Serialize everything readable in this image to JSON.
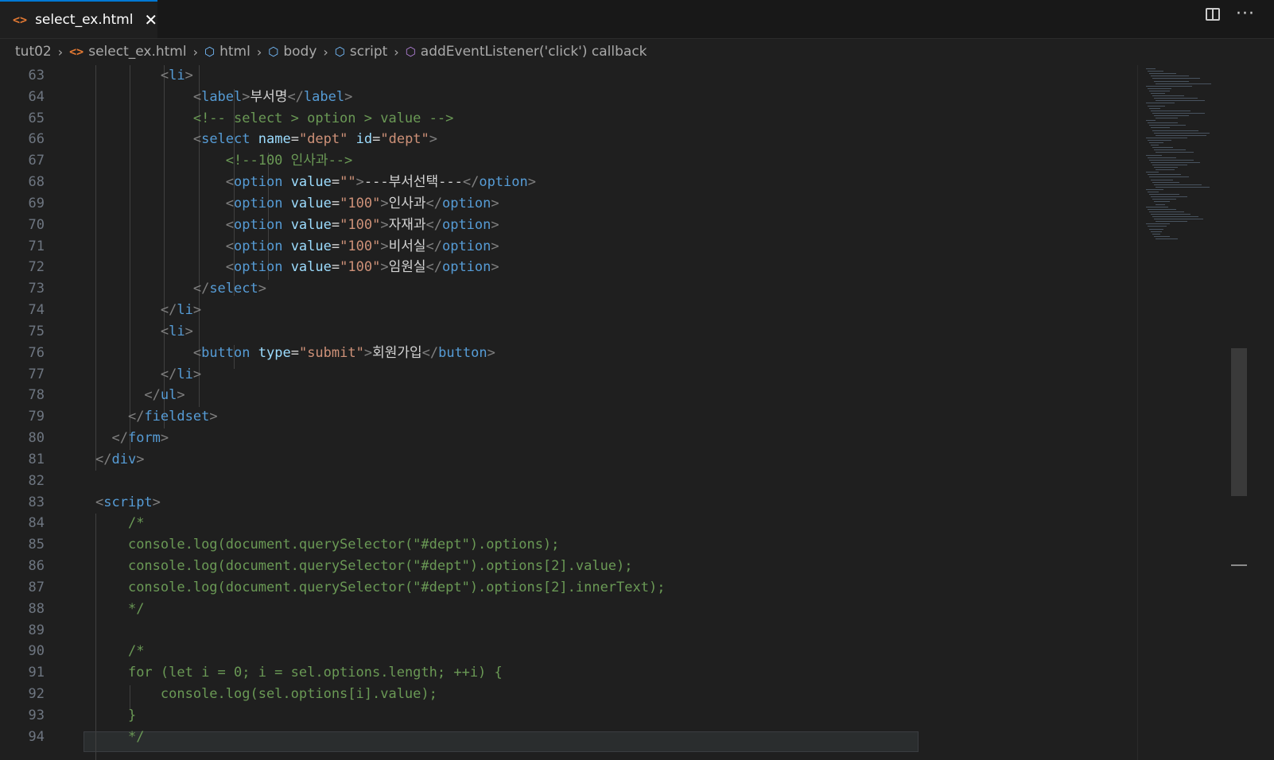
{
  "tab": {
    "label": "select_ex.html",
    "icon": "html-file-icon",
    "close_glyph": "✕"
  },
  "tab_actions": {
    "split_editor": "split-editor-icon",
    "more": "···"
  },
  "breadcrumb": [
    {
      "label": "tut02",
      "icon": ""
    },
    {
      "label": "select_ex.html",
      "icon": "html-file-icon"
    },
    {
      "label": "html",
      "icon": "symbol-element-icon"
    },
    {
      "label": "body",
      "icon": "symbol-element-icon"
    },
    {
      "label": "script",
      "icon": "symbol-element-icon"
    },
    {
      "label": "addEventListener('click') callback",
      "icon": "symbol-method-icon"
    }
  ],
  "line_numbers": [
    "63",
    "64",
    "65",
    "66",
    "67",
    "68",
    "69",
    "70",
    "71",
    "72",
    "73",
    "74",
    "75",
    "76",
    "77",
    "78",
    "79",
    "80",
    "81",
    "82",
    "83",
    "84",
    "85",
    "86",
    "87",
    "88",
    "89",
    "90",
    "91",
    "92",
    "93",
    "94"
  ],
  "code_lines": [
    [
      [
        "        ",
        "x"
      ],
      [
        "<",
        "p"
      ],
      [
        "li",
        "t"
      ],
      [
        ">",
        "p"
      ]
    ],
    [
      [
        "            ",
        "x"
      ],
      [
        "<",
        "p"
      ],
      [
        "label",
        "t"
      ],
      [
        ">",
        "p"
      ],
      [
        "부서명",
        "x"
      ],
      [
        "</",
        "p"
      ],
      [
        "label",
        "t"
      ],
      [
        ">",
        "p"
      ]
    ],
    [
      [
        "            ",
        "x"
      ],
      [
        "<!-- select > option > value -->",
        "c"
      ]
    ],
    [
      [
        "            ",
        "x"
      ],
      [
        "<",
        "p"
      ],
      [
        "select",
        "t"
      ],
      [
        " ",
        "x"
      ],
      [
        "name",
        "a"
      ],
      [
        "=",
        "x"
      ],
      [
        "\"dept\"",
        "s"
      ],
      [
        " ",
        "x"
      ],
      [
        "id",
        "a"
      ],
      [
        "=",
        "x"
      ],
      [
        "\"dept\"",
        "s"
      ],
      [
        ">",
        "p"
      ]
    ],
    [
      [
        "                ",
        "x"
      ],
      [
        "<!--100 인사과-->",
        "c"
      ]
    ],
    [
      [
        "                ",
        "x"
      ],
      [
        "<",
        "p"
      ],
      [
        "option",
        "t"
      ],
      [
        " ",
        "x"
      ],
      [
        "value",
        "a"
      ],
      [
        "=",
        "x"
      ],
      [
        "\"\"",
        "s"
      ],
      [
        ">",
        "p"
      ],
      [
        "---부서선택---",
        "x"
      ],
      [
        "</",
        "p"
      ],
      [
        "option",
        "t"
      ],
      [
        ">",
        "p"
      ]
    ],
    [
      [
        "                ",
        "x"
      ],
      [
        "<",
        "p"
      ],
      [
        "option",
        "t"
      ],
      [
        " ",
        "x"
      ],
      [
        "value",
        "a"
      ],
      [
        "=",
        "x"
      ],
      [
        "\"100\"",
        "s"
      ],
      [
        ">",
        "p"
      ],
      [
        "인사과",
        "x"
      ],
      [
        "</",
        "p"
      ],
      [
        "option",
        "t"
      ],
      [
        ">",
        "p"
      ]
    ],
    [
      [
        "                ",
        "x"
      ],
      [
        "<",
        "p"
      ],
      [
        "option",
        "t"
      ],
      [
        " ",
        "x"
      ],
      [
        "value",
        "a"
      ],
      [
        "=",
        "x"
      ],
      [
        "\"100\"",
        "s"
      ],
      [
        ">",
        "p"
      ],
      [
        "자재과",
        "x"
      ],
      [
        "</",
        "p"
      ],
      [
        "option",
        "t"
      ],
      [
        ">",
        "p"
      ]
    ],
    [
      [
        "                ",
        "x"
      ],
      [
        "<",
        "p"
      ],
      [
        "option",
        "t"
      ],
      [
        " ",
        "x"
      ],
      [
        "value",
        "a"
      ],
      [
        "=",
        "x"
      ],
      [
        "\"100\"",
        "s"
      ],
      [
        ">",
        "p"
      ],
      [
        "비서실",
        "x"
      ],
      [
        "</",
        "p"
      ],
      [
        "option",
        "t"
      ],
      [
        ">",
        "p"
      ]
    ],
    [
      [
        "                ",
        "x"
      ],
      [
        "<",
        "p"
      ],
      [
        "option",
        "t"
      ],
      [
        " ",
        "x"
      ],
      [
        "value",
        "a"
      ],
      [
        "=",
        "x"
      ],
      [
        "\"100\"",
        "s"
      ],
      [
        ">",
        "p"
      ],
      [
        "임원실",
        "x"
      ],
      [
        "</",
        "p"
      ],
      [
        "option",
        "t"
      ],
      [
        ">",
        "p"
      ]
    ],
    [
      [
        "            ",
        "x"
      ],
      [
        "</",
        "p"
      ],
      [
        "select",
        "t"
      ],
      [
        ">",
        "p"
      ]
    ],
    [
      [
        "        ",
        "x"
      ],
      [
        "</",
        "p"
      ],
      [
        "li",
        "t"
      ],
      [
        ">",
        "p"
      ]
    ],
    [
      [
        "        ",
        "x"
      ],
      [
        "<",
        "p"
      ],
      [
        "li",
        "t"
      ],
      [
        ">",
        "p"
      ]
    ],
    [
      [
        "            ",
        "x"
      ],
      [
        "<",
        "p"
      ],
      [
        "button",
        "t"
      ],
      [
        " ",
        "x"
      ],
      [
        "type",
        "a"
      ],
      [
        "=",
        "x"
      ],
      [
        "\"submit\"",
        "s"
      ],
      [
        ">",
        "p"
      ],
      [
        "회원가입",
        "x"
      ],
      [
        "</",
        "p"
      ],
      [
        "button",
        "t"
      ],
      [
        ">",
        "p"
      ]
    ],
    [
      [
        "        ",
        "x"
      ],
      [
        "</",
        "p"
      ],
      [
        "li",
        "t"
      ],
      [
        ">",
        "p"
      ]
    ],
    [
      [
        "      ",
        "x"
      ],
      [
        "</",
        "p"
      ],
      [
        "ul",
        "t"
      ],
      [
        ">",
        "p"
      ]
    ],
    [
      [
        "    ",
        "x"
      ],
      [
        "</",
        "p"
      ],
      [
        "fieldset",
        "t"
      ],
      [
        ">",
        "p"
      ]
    ],
    [
      [
        "  ",
        "x"
      ],
      [
        "</",
        "p"
      ],
      [
        "form",
        "t"
      ],
      [
        ">",
        "p"
      ]
    ],
    [
      [
        "",
        "x"
      ],
      [
        "</",
        "p"
      ],
      [
        "div",
        "t"
      ],
      [
        ">",
        "p"
      ]
    ],
    [
      [
        "",
        "x"
      ]
    ],
    [
      [
        "",
        "x"
      ],
      [
        "<",
        "p"
      ],
      [
        "script",
        "t"
      ],
      [
        ">",
        "p"
      ]
    ],
    [
      [
        "    ",
        "x"
      ],
      [
        "/*",
        "c"
      ]
    ],
    [
      [
        "    ",
        "x"
      ],
      [
        "console.log(document.querySelector(\"#dept\").options);",
        "c"
      ]
    ],
    [
      [
        "    ",
        "x"
      ],
      [
        "console.log(document.querySelector(\"#dept\").options[2].value);",
        "c"
      ]
    ],
    [
      [
        "    ",
        "x"
      ],
      [
        "console.log(document.querySelector(\"#dept\").options[2].innerText);",
        "c"
      ]
    ],
    [
      [
        "    ",
        "x"
      ],
      [
        "*/",
        "c"
      ]
    ],
    [
      [
        "",
        "x"
      ]
    ],
    [
      [
        "    ",
        "x"
      ],
      [
        "/*",
        "c"
      ]
    ],
    [
      [
        "    ",
        "x"
      ],
      [
        "for (let i = 0; i = sel.options.length; ++i) {",
        "c"
      ]
    ],
    [
      [
        "        ",
        "x"
      ],
      [
        "console.log(sel.options[i].value);",
        "c"
      ]
    ],
    [
      [
        "    ",
        "x"
      ],
      [
        "}",
        "c"
      ]
    ],
    [
      [
        "    ",
        "x"
      ],
      [
        "*/",
        "c"
      ]
    ]
  ]
}
